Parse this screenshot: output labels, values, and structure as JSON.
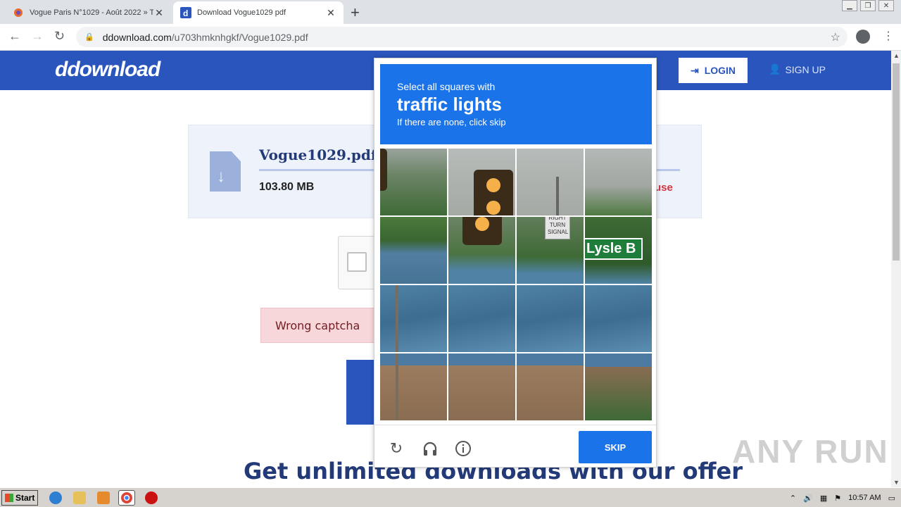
{
  "browser": {
    "tabs": [
      {
        "title": "Vogue Paris N°1029 - Août 2022 » To",
        "active": false
      },
      {
        "title": "Download Vogue1029 pdf",
        "active": true
      }
    ],
    "url_host": "ddownload.com",
    "url_path": "/u703hmknhgkf/Vogue1029.pdf"
  },
  "site": {
    "logo": "ddownload",
    "login_label": "LOGIN",
    "signup_label": "SIGN UP",
    "brand_color": "#2a55bd"
  },
  "file": {
    "name": "Vogue1029.pdf",
    "size": "103.80 MB",
    "report_partial": "use"
  },
  "captcha_error": "Wrong captcha",
  "promo_text": "Get unlimited downloads with our offer",
  "challenge": {
    "prompt": "Select all squares with",
    "target": "traffic lights",
    "hint": "If there are none, click skip",
    "skip_label": "SKIP",
    "sign_text": "Lysle B",
    "small_sign": "RIGHT TURN SIGNAL",
    "header_color": "#1a73e8",
    "footer_icons": [
      "refresh-icon",
      "headphones-icon",
      "info-icon"
    ]
  },
  "watermark": "ANY RUN",
  "taskbar": {
    "start_label": "Start",
    "clock": "10:57 AM"
  }
}
